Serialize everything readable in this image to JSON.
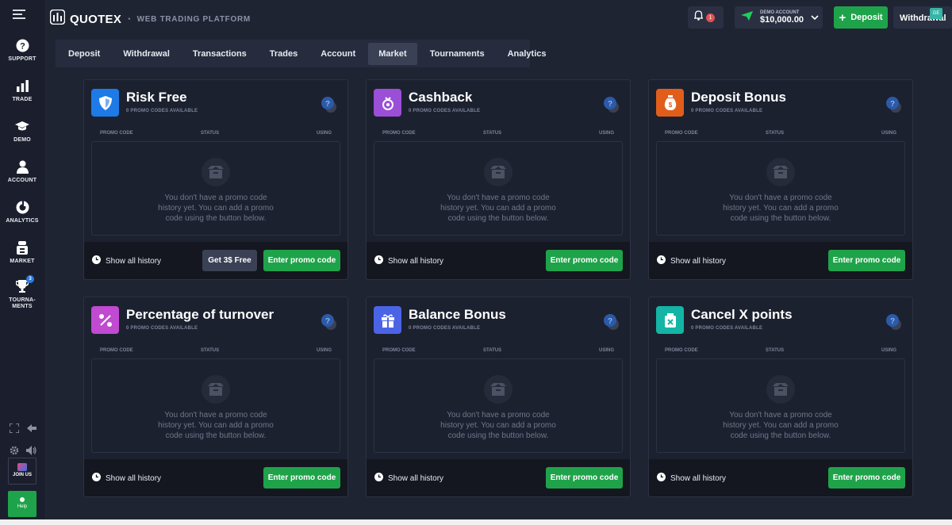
{
  "header": {
    "brand": "QUOTEX",
    "subtitle": "WEB TRADING PLATFORM",
    "notifications": "1",
    "account": {
      "label": "DEMO ACCOUNT",
      "balance": "$10,000.00"
    },
    "deposit_label": "Deposit",
    "withdraw_label": "Withdrawal",
    "corner_badge": "GE"
  },
  "sidebar": {
    "items": [
      {
        "label": "SUPPORT",
        "icon": "help-circle-icon"
      },
      {
        "label": "TRADE",
        "icon": "bar-chart-icon"
      },
      {
        "label": "DEMO",
        "icon": "graduation-cap-icon"
      },
      {
        "label": "ACCOUNT",
        "icon": "user-icon"
      },
      {
        "label": "ANALYTICS",
        "icon": "pie-chart-icon"
      },
      {
        "label": "MARKET",
        "icon": "shop-icon"
      },
      {
        "label": "TOURNA-\nMENTS",
        "icon": "trophy-icon",
        "badge": "3"
      }
    ],
    "join_label": "JOIN US",
    "help_label": "Help"
  },
  "tabs": {
    "items": [
      "Deposit",
      "Withdrawal",
      "Transactions",
      "Trades",
      "Account",
      "Market",
      "Tournaments",
      "Analytics"
    ],
    "active": "Market"
  },
  "common": {
    "codes_available": "0 PROMO CODES AVAILABLE",
    "col_promo": "PROMO CODE",
    "col_status": "STATUS",
    "col_using": "USING",
    "empty_text": "You don't have a promo code history yet. You can add a promo code using the button below.",
    "history_label": "Show all history",
    "enter_label": "Enter promo code",
    "free_label": "Get 3$ Free"
  },
  "cards": [
    {
      "title": "Risk Free",
      "icon": "shield-icon",
      "color": "#1e7ae6"
    },
    {
      "title": "Cashback",
      "icon": "coins-icon",
      "color": "#9a4fd6"
    },
    {
      "title": "Deposit Bonus",
      "icon": "money-bag-icon",
      "color": "#e05e1a"
    },
    {
      "title": "Percentage of turnover",
      "icon": "percent-icon",
      "color": "#c04ad0"
    },
    {
      "title": "Balance Bonus",
      "icon": "gift-icon",
      "color": "#4b64e6"
    },
    {
      "title": "Cancel X points",
      "icon": "cancel-icon",
      "color": "#14b5a4"
    }
  ]
}
